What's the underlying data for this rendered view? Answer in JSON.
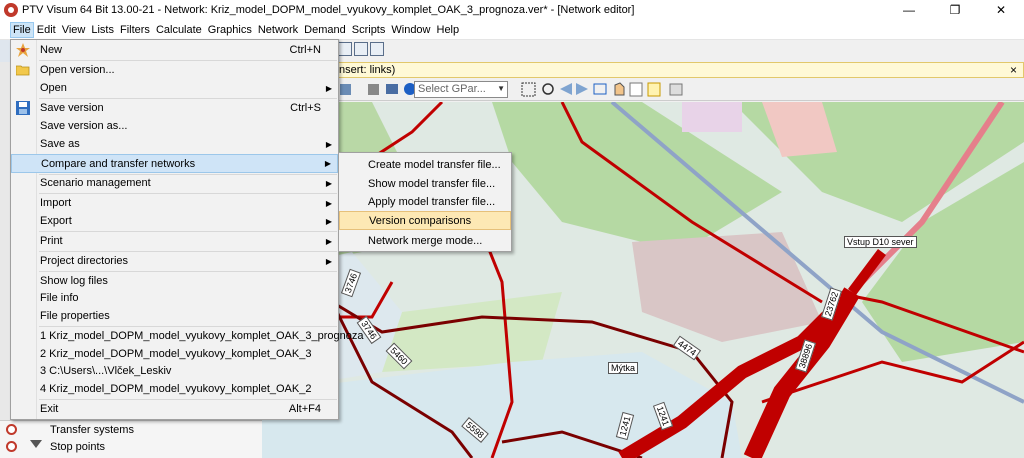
{
  "window": {
    "title": "PTV Visum 64 Bit 13.00-21 - Network: Kriz_model_DOPM_model_vyukovy_komplet_OAK_3_prognoza.ver* - [Network editor]",
    "controls": {
      "minimize": "—",
      "restore": "❐",
      "close": "✕"
    }
  },
  "menubar": {
    "items": [
      "File",
      "Edit",
      "View",
      "Lists",
      "Filters",
      "Calculate",
      "Graphics",
      "Network",
      "Demand",
      "Scripts",
      "Window",
      "Help"
    ]
  },
  "info_bar": {
    "text": "nsert: links)",
    "close": "×"
  },
  "map_toolbar": {
    "select_gpar": "Select GPar..."
  },
  "left_panel": {
    "row1_label": "Transfer systems",
    "row2_label": "Stop points"
  },
  "file_menu": {
    "items": [
      {
        "label": "New",
        "shortcut": "Ctrl+N",
        "icon": "new-icon"
      },
      {
        "label": "Open version...",
        "shortcut": "",
        "icon": "open-folder-icon"
      },
      {
        "label": "Open",
        "shortcut": "",
        "submenu": true
      },
      {
        "label": "Save version",
        "shortcut": "Ctrl+S",
        "icon": "save-icon"
      },
      {
        "label": "Save version as...",
        "shortcut": ""
      },
      {
        "label": "Save as",
        "shortcut": "",
        "submenu": true
      },
      {
        "label": "Compare and transfer networks",
        "shortcut": "",
        "submenu": true,
        "highlighted": true
      },
      {
        "label": "Scenario management",
        "shortcut": "",
        "submenu": true
      },
      {
        "label": "Import",
        "shortcut": "",
        "submenu": true
      },
      {
        "label": "Export",
        "shortcut": "",
        "submenu": true
      },
      {
        "label": "Print",
        "shortcut": "",
        "submenu": true
      },
      {
        "label": "Project directories",
        "shortcut": "",
        "submenu": true
      },
      {
        "label": "Show log files",
        "shortcut": ""
      },
      {
        "label": "File info",
        "shortcut": ""
      },
      {
        "label": "File properties",
        "shortcut": ""
      },
      {
        "label": "1 Kriz_model_DOPM_model_vyukovy_komplet_OAK_3_prognoza",
        "shortcut": ""
      },
      {
        "label": "2 Kriz_model_DOPM_model_vyukovy_komplet_OAK_3",
        "shortcut": ""
      },
      {
        "label": "3 C:\\Users\\...\\Vlček_Leskiv",
        "shortcut": ""
      },
      {
        "label": "4 Kriz_model_DOPM_model_vyukovy_komplet_OAK_2",
        "shortcut": ""
      },
      {
        "label": "Exit",
        "shortcut": "Alt+F4"
      }
    ],
    "submenu_arrow": "▶"
  },
  "compare_submenu": {
    "items": [
      {
        "label": "Create model transfer file..."
      },
      {
        "label": "Show model transfer file..."
      },
      {
        "label": "Apply model transfer file..."
      },
      {
        "label": "Version comparisons",
        "highlighted": true
      },
      {
        "label": "Network merge mode..."
      }
    ]
  },
  "map": {
    "place_labels": [
      "Vstup D10 sever",
      "Mýtka"
    ],
    "link_volumes": [
      "3746",
      "3746",
      "5460",
      "4474",
      "5598",
      "1241",
      "1241",
      "23762",
      "38896"
    ]
  },
  "colors": {
    "menu_highlight": "#cfe4f7",
    "submenu_highlight": "#fde8b4",
    "link_red": "#c00000",
    "link_dark": "#7a0000",
    "park_green": "#b5d9a3",
    "residential": "#e0dfdf"
  }
}
